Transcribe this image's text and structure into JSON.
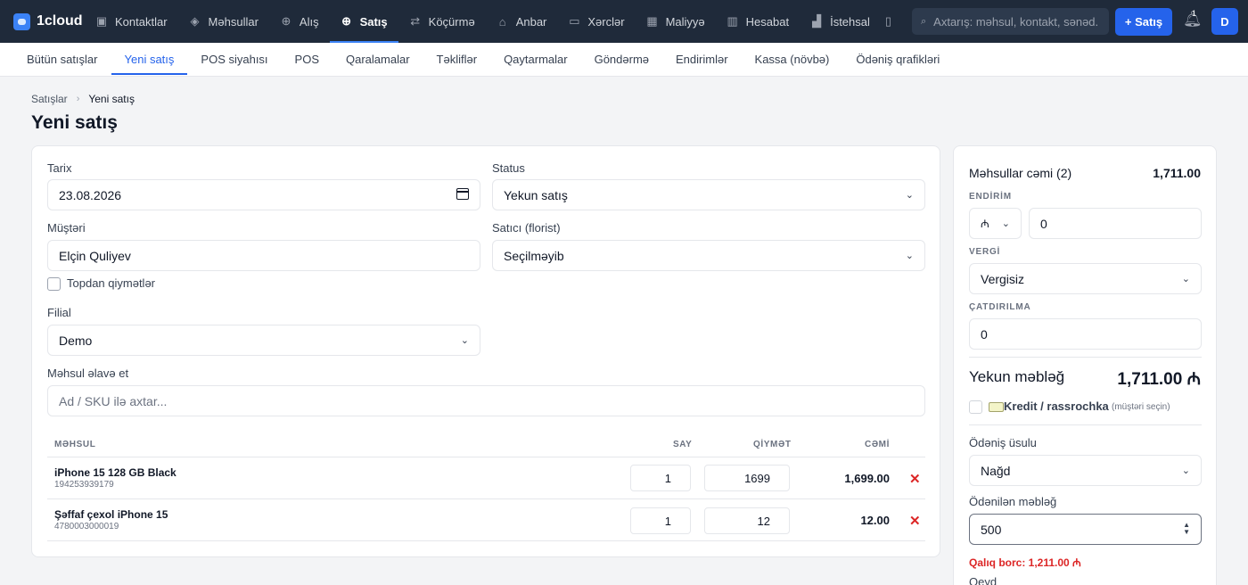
{
  "app": {
    "name": "1cloud"
  },
  "nav": [
    {
      "label": "Kontaktlar",
      "icon": "contacts-icon",
      "glyph": "▣"
    },
    {
      "label": "Məhsullar",
      "icon": "box-icon",
      "glyph": "◈"
    },
    {
      "label": "Alış",
      "icon": "download-icon",
      "glyph": "⊕"
    },
    {
      "label": "Satış",
      "icon": "sale-icon",
      "glyph": "⊕",
      "active": true
    },
    {
      "label": "Köçürmə",
      "icon": "transfer-icon",
      "glyph": "⇄"
    },
    {
      "label": "Anbar",
      "icon": "warehouse-icon",
      "glyph": "⌂"
    },
    {
      "label": "Xərclər",
      "icon": "expenses-icon",
      "glyph": "▭"
    },
    {
      "label": "Maliyyə",
      "icon": "finance-icon",
      "glyph": "▦"
    },
    {
      "label": "Hesabat",
      "icon": "report-icon",
      "glyph": "▥"
    },
    {
      "label": "İstehsal",
      "icon": "production-icon",
      "glyph": "▟"
    }
  ],
  "search": {
    "placeholder": "Axtarış: məhsul, kontakt, sənəd..."
  },
  "header": {
    "new_sale_label": "+ Satış",
    "notification_count": "1",
    "avatar_letter": "D"
  },
  "subnav": [
    {
      "label": "Bütün satışlar"
    },
    {
      "label": "Yeni satış",
      "active": true
    },
    {
      "label": "POS siyahısı"
    },
    {
      "label": "POS"
    },
    {
      "label": "Qaralamalar"
    },
    {
      "label": "Təkliflər"
    },
    {
      "label": "Qaytarmalar"
    },
    {
      "label": "Göndərmə"
    },
    {
      "label": "Endirimlər"
    },
    {
      "label": "Kassa (növbə)"
    },
    {
      "label": "Ödəniş qrafikləri"
    }
  ],
  "breadcrumb": {
    "parent": "Satışlar",
    "current": "Yeni satış"
  },
  "page_title": "Yeni satış",
  "form": {
    "date_label": "Tarix",
    "date_value": "23.08.2026",
    "status_label": "Status",
    "status_value": "Yekun satış",
    "customer_label": "Müştəri",
    "customer_value": "Elçin Quliyev",
    "seller_label": "Satıcı (florist)",
    "seller_value": "Seçilməyib",
    "wholesale_label": "Topdan qiymətlər",
    "branch_label": "Filial",
    "branch_value": "Demo",
    "add_product_label": "Məhsul əlavə et",
    "add_product_placeholder": "Ad / SKU ilə axtar..."
  },
  "table": {
    "headers": {
      "product": "MƏHSUL",
      "qty": "SAY",
      "price": "QİYMƏT",
      "total": "CƏMİ"
    },
    "rows": [
      {
        "name": "iPhone 15 128 GB Black",
        "sku": "194253939179",
        "qty": "1",
        "price": "1699",
        "total": "1,699.00"
      },
      {
        "name": "Şəffaf çexol iPhone 15",
        "sku": "4780003000019",
        "qty": "1",
        "price": "12",
        "total": "12.00"
      }
    ],
    "delete_glyph": "✕"
  },
  "summary": {
    "products_total_label": "Məhsullar cəmi (2)",
    "products_total": "1,711.00",
    "discount_label": "ENDİRİM",
    "discount_type": "₼",
    "discount_value": "0",
    "tax_label": "VERGİ",
    "tax_value": "Vergisiz",
    "delivery_label": "ÇATDIRILMA",
    "delivery_value": "0",
    "final_label": "Yekun məbləğ",
    "final_value": "1,711.00 ₼",
    "credit_label": "Kredit / rassrochka",
    "credit_hint": "(müştəri seçin)",
    "payment_method_label": "Ödəniş üsulu",
    "payment_method_value": "Nağd",
    "paid_label": "Ödənilən məbləğ",
    "paid_value": "500",
    "remaining": "Qalıq borc: 1,211.00 ₼",
    "note_label": "Qeyd"
  },
  "colors": {
    "nav_bg": "#1f2a3a",
    "accent": "#2563eb",
    "danger": "#dc2626"
  }
}
